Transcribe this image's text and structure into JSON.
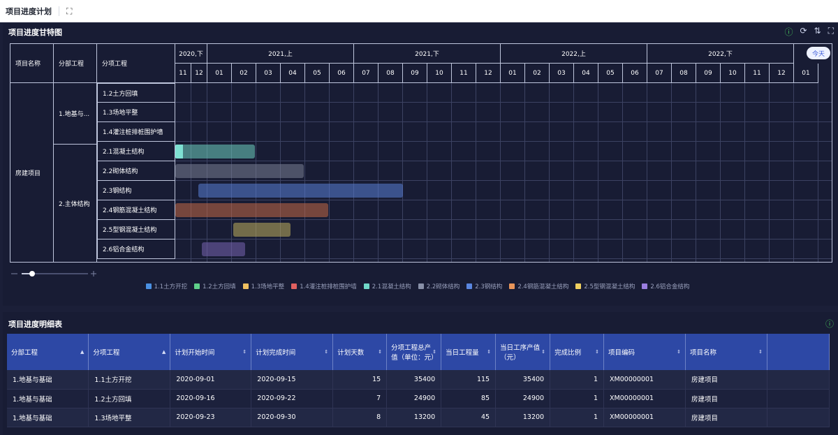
{
  "topbar": {
    "title": "项目进度计划",
    "expand_icon": "expand-icon"
  },
  "gantt_panel": {
    "title": "项目进度甘特图",
    "today_label": "今天"
  },
  "gantt": {
    "headers": {
      "project": "项目名称",
      "sub": "分部工程",
      "item": "分项工程"
    },
    "periods": [
      "2020,下",
      "2021,上",
      "2021,下",
      "2022,上",
      "2022,下"
    ],
    "months": [
      "11",
      "12",
      "01",
      "02",
      "03",
      "04",
      "05",
      "06",
      "07",
      "08",
      "09",
      "10",
      "11",
      "12",
      "01",
      "02",
      "03",
      "04",
      "05",
      "06",
      "07",
      "08",
      "09",
      "10",
      "11",
      "12",
      "01"
    ],
    "project_name": "房建项目",
    "groups": [
      "1.地基与...",
      "2.主体结构"
    ],
    "rows": [
      "1.2土方回填",
      "1.3场地平整",
      "1.4灌注桩排桩围护墙",
      "2.1混凝土结构",
      "2.2砌体结构",
      "2.3钢结构",
      "2.4钢筋混凝土结构",
      "2.5型钢混凝土结构",
      "2.6铝合金结构"
    ],
    "bars": [
      {
        "row": 3,
        "start": 0.0,
        "end": 3.95,
        "color": "#6fcfc0"
      },
      {
        "row": 4,
        "start": 0.0,
        "end": 5.95,
        "color": "#7a7f94"
      },
      {
        "row": 5,
        "start": 1.45,
        "end": 10.0,
        "color": "#5a7fd6"
      },
      {
        "row": 6,
        "start": 0.0,
        "end": 6.95,
        "color": "#c46a45"
      },
      {
        "row": 7,
        "start": 3.05,
        "end": 5.4,
        "color": "#bfae5c"
      },
      {
        "row": 8,
        "start": 1.65,
        "end": 3.55,
        "color": "#7865b0"
      }
    ]
  },
  "legend": [
    {
      "label": "1.1土方开挖",
      "color": "#4a90e2"
    },
    {
      "label": "1.2土方回填",
      "color": "#5fd08a"
    },
    {
      "label": "1.3场地平整",
      "color": "#f0c060"
    },
    {
      "label": "1.4灌注桩排桩围护墙",
      "color": "#e06060"
    },
    {
      "label": "2.1混凝土结构",
      "color": "#70d8c8"
    },
    {
      "label": "2.2砌体结构",
      "color": "#8890a8"
    },
    {
      "label": "2.3钢结构",
      "color": "#5a86e0"
    },
    {
      "label": "2.4钢筋混凝土结构",
      "color": "#e8955a"
    },
    {
      "label": "2.5型钢混凝土结构",
      "color": "#f0d060"
    },
    {
      "label": "2.6铝合金结构",
      "color": "#9a7ee0"
    }
  ],
  "detail": {
    "title": "项目进度明细表",
    "columns": [
      "分部工程",
      "分项工程",
      "计划开始时间",
      "计划完成时间",
      "计划天数",
      "分项工程总产值（单位：元）",
      "当日工程量",
      "当日工序产值（元）",
      "完成比例",
      "项目编码",
      "项目名称"
    ],
    "rows": [
      [
        "1.地基与基础",
        "1.1土方开挖",
        "2020-09-01",
        "2020-09-15",
        "15",
        "35400",
        "115",
        "35400",
        "1",
        "XM00000001",
        "房建项目"
      ],
      [
        "1.地基与基础",
        "1.2土方回填",
        "2020-09-16",
        "2020-09-22",
        "7",
        "24900",
        "85",
        "24900",
        "1",
        "XM00000001",
        "房建项目"
      ],
      [
        "1.地基与基础",
        "1.3场地平整",
        "2020-09-23",
        "2020-09-30",
        "8",
        "13200",
        "45",
        "13200",
        "1",
        "XM00000001",
        "房建项目"
      ]
    ]
  }
}
